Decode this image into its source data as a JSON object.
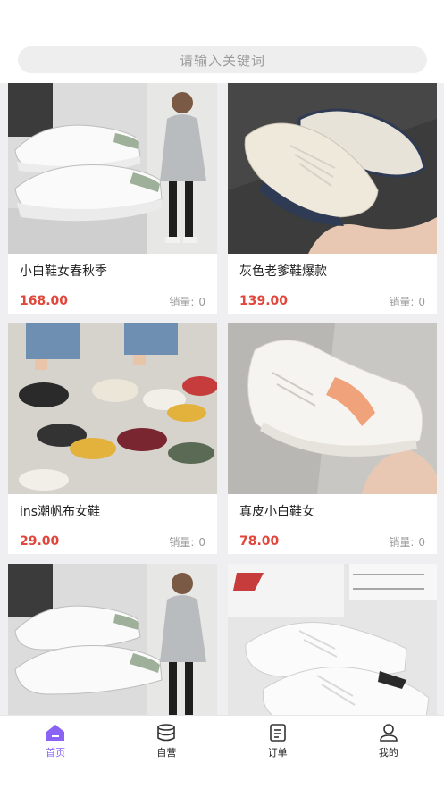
{
  "search": {
    "placeholder": "请输入关键词"
  },
  "products": [
    {
      "title": "小白鞋女春秋季",
      "price": "168.00",
      "sales_label": "销量:",
      "sales_count": "0",
      "image": "white-sneakers-photo"
    },
    {
      "title": "灰色老爹鞋爆款",
      "price": "139.00",
      "sales_label": "销量:",
      "sales_count": "0",
      "image": "chunky-dad-sneaker-photo"
    },
    {
      "title": "ins潮帆布女鞋",
      "price": "29.00",
      "sales_label": "销量:",
      "sales_count": "0",
      "image": "canvas-shoes-collage-photo"
    },
    {
      "title": "真皮小白鞋女",
      "price": "78.00",
      "sales_label": "销量:",
      "sales_count": "0",
      "image": "leather-white-sneaker-photo"
    },
    {
      "title": "",
      "price": "",
      "sales_label": "",
      "sales_count": "",
      "image": "white-sneakers-photo"
    },
    {
      "title": "",
      "price": "",
      "sales_label": "",
      "sales_count": "",
      "image": "knit-white-sneakers-photo"
    }
  ],
  "tabs": [
    {
      "label": "首页",
      "icon": "home-icon",
      "active": true
    },
    {
      "label": "自营",
      "icon": "database-icon",
      "active": false
    },
    {
      "label": "订单",
      "icon": "order-list-icon",
      "active": false
    },
    {
      "label": "我的",
      "icon": "user-icon",
      "active": false
    }
  ],
  "colors": {
    "accent": "#8a63f5",
    "price": "#e0463a",
    "background": "#efeff1"
  }
}
